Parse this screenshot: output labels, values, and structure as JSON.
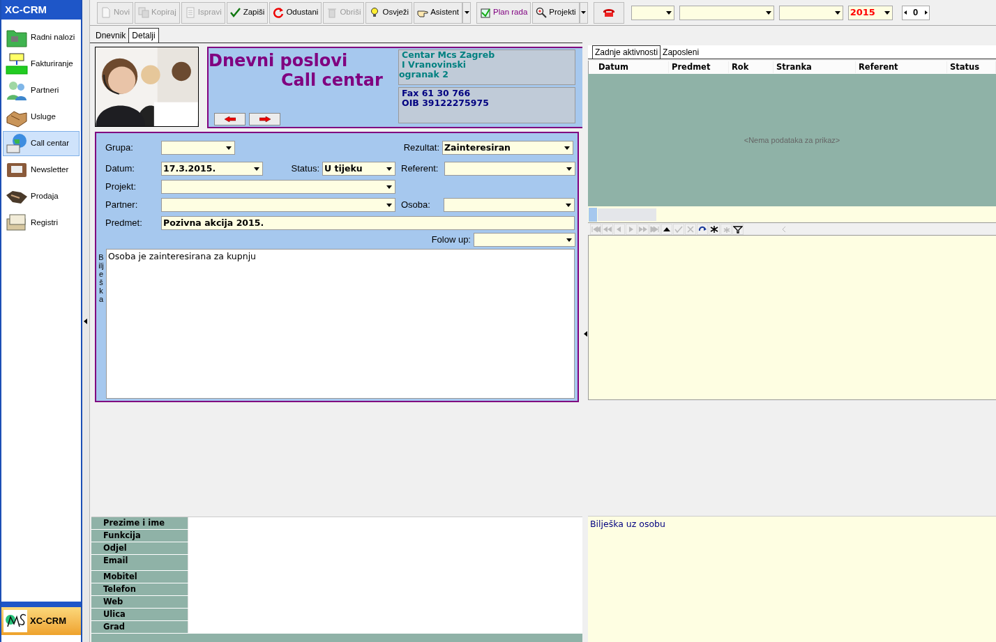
{
  "app_title": "XC-CRM",
  "sidebar": {
    "items": [
      {
        "label": "Radni nalozi",
        "selected": false
      },
      {
        "label": "Fakturiranje",
        "selected": false
      },
      {
        "label": "Partneri",
        "selected": false
      },
      {
        "label": "Usluge",
        "selected": false
      },
      {
        "label": "Call centar",
        "selected": true
      },
      {
        "label": "Newsletter",
        "selected": false
      },
      {
        "label": "Prodaja",
        "selected": false
      },
      {
        "label": "Registri",
        "selected": false
      }
    ],
    "footer": "XC-CRM"
  },
  "toolbar": [
    {
      "label": "Novi",
      "disabled": true,
      "has_menu": false
    },
    {
      "label": "Kopiraj",
      "disabled": true,
      "has_menu": false
    },
    {
      "label": "Ispravi",
      "disabled": true,
      "has_menu": false
    },
    {
      "label": "Zapiši",
      "disabled": false,
      "has_menu": false
    },
    {
      "label": "Odustani",
      "disabled": false,
      "has_menu": false
    },
    {
      "label": "Obriši",
      "disabled": true,
      "has_menu": false
    },
    {
      "label": "Osvježi",
      "disabled": false,
      "has_menu": false
    },
    {
      "label": "Asistent",
      "disabled": false,
      "has_menu": true
    },
    {
      "label": "Plan rada",
      "disabled": false,
      "has_menu": false
    },
    {
      "label": "Projekti",
      "disabled": false,
      "has_menu": true
    }
  ],
  "filters": [
    {
      "kind": "combo"
    },
    {
      "kind": "combo"
    },
    {
      "kind": "combo"
    },
    {
      "kind": "combo",
      "value": "2015"
    }
  ],
  "counter": "0",
  "tabs": [
    {
      "label": "Dnevnik",
      "selected": false
    },
    {
      "label": "Detalji",
      "selected": true
    }
  ],
  "header": {
    "title": "Dnevni poslovi",
    "subtitle": "Call centar",
    "address": [
      "Centar Mcs Zagreb",
      "I Vranovinski",
      "ogranak 2"
    ],
    "contact": [
      "Fax 61 30 766",
      "OIB 39122275975"
    ]
  },
  "form": {
    "grupa": {
      "label": "Grupa:"
    },
    "rezultat": {
      "label": "Rezultat:",
      "value": "Zainteresiran"
    },
    "datum": {
      "label": "Datum:",
      "value": "17.3.2015."
    },
    "status": {
      "label": "Status:",
      "value": "U tijeku"
    },
    "referent": {
      "label": "Referent:"
    },
    "projekt": {
      "label": "Projekt:"
    },
    "partner": {
      "label": "Partner:"
    },
    "osoba": {
      "label": "Osoba:"
    },
    "predmet": {
      "label": "Predmet:",
      "value": "Pozivna akcija 2015."
    },
    "folow_up": {
      "label": "Folow up:"
    },
    "note_label": "Bilješka",
    "note": "Osoba je zainteresirana za kupnju"
  },
  "contact_fields": [
    "Prezime i ime",
    "Funkcija",
    "Odjel",
    "Email",
    "Mobitel",
    "Telefon",
    "Web",
    "Ulica",
    "Grad"
  ],
  "right_tabs": [
    {
      "label": "Zadnje aktivnosti",
      "selected": true
    },
    {
      "label": "Zaposleni",
      "selected": false
    }
  ],
  "grid": {
    "columns": [
      "Datum",
      "Predmet",
      "Rok",
      "Stranka",
      "Referent",
      "Status"
    ],
    "empty_text": "<Nema podataka za prikaz>"
  },
  "person_note": "Bilješka uz osobu"
}
